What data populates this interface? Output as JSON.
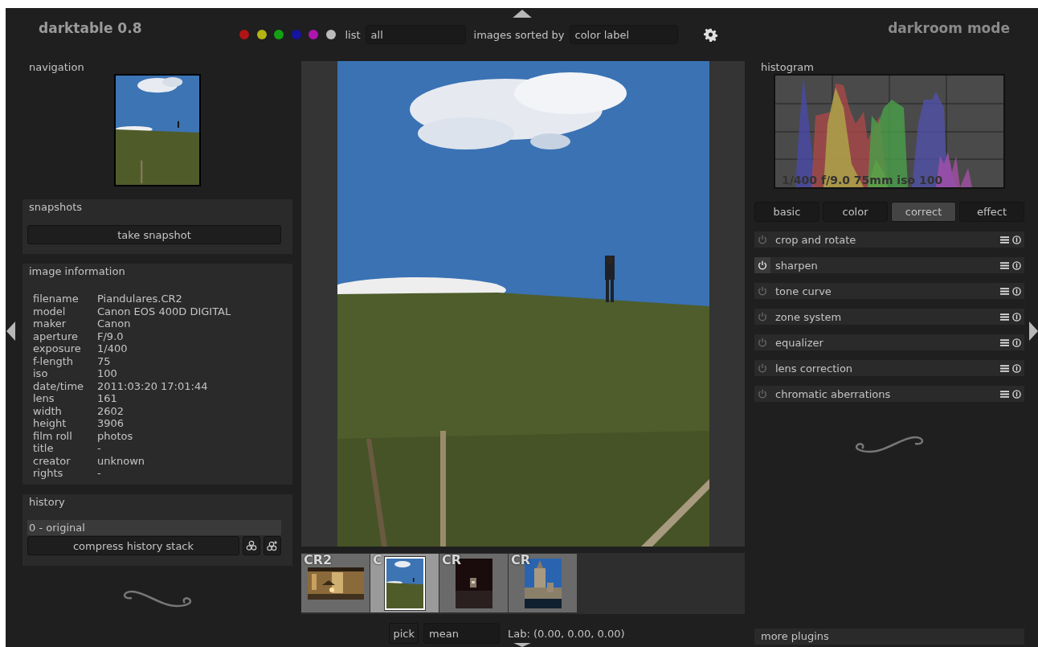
{
  "header": {
    "title": "darktable 0.8",
    "color_labels": [
      {
        "color": "#b01414"
      },
      {
        "color": "#b4b414"
      },
      {
        "color": "#14a014"
      },
      {
        "color": "#1414a0"
      },
      {
        "color": "#b014b0"
      },
      {
        "color": "#bbbbbb"
      }
    ],
    "filter_label": "list",
    "filter": {
      "value": "all"
    },
    "sort_label": "images sorted by",
    "sort": {
      "value": "color label"
    },
    "mode": "darkroom mode"
  },
  "left_panel": {
    "navigation": {
      "title": "navigation"
    },
    "snapshots": {
      "title": "snapshots",
      "button": "take snapshot"
    },
    "image_information": {
      "title": "image information",
      "rows": [
        {
          "label": "filename",
          "value": "Piandulares.CR2"
        },
        {
          "label": "model",
          "value": "Canon EOS 400D DIGITAL"
        },
        {
          "label": "maker",
          "value": "Canon"
        },
        {
          "label": "aperture",
          "value": "F/9.0"
        },
        {
          "label": "exposure",
          "value": "1/400"
        },
        {
          "label": "f-length",
          "value": "75"
        },
        {
          "label": "iso",
          "value": "100"
        },
        {
          "label": "date/time",
          "value": "2011:03:20 17:01:44"
        },
        {
          "label": "lens",
          "value": "161"
        },
        {
          "label": "width",
          "value": "2602"
        },
        {
          "label": "height",
          "value": "3906"
        },
        {
          "label": "film roll",
          "value": "photos"
        },
        {
          "label": "title",
          "value": "-"
        },
        {
          "label": "creator",
          "value": "unknown"
        },
        {
          "label": "rights",
          "value": "-"
        }
      ]
    },
    "history": {
      "title": "history",
      "items": [
        {
          "label": "0 - original",
          "selected": true
        }
      ],
      "button": "compress history stack"
    }
  },
  "filmstrip": [
    {
      "label": "CR2",
      "selected": false
    },
    {
      "label": "C",
      "selected": true
    },
    {
      "label": "CR",
      "selected": false
    },
    {
      "label": "CR",
      "selected": false
    }
  ],
  "bottom_bar": {
    "button": "pick",
    "mode": {
      "value": "mean"
    },
    "reading": "Lab: (0.00, 0.00, 0.00)"
  },
  "right_panel": {
    "histogram": {
      "title": "histogram",
      "overlay": "1/400 f/9.0 75mm iso 100"
    },
    "groups": [
      {
        "label": "basic",
        "selected": false
      },
      {
        "label": "color",
        "selected": false
      },
      {
        "label": "correct",
        "selected": true
      },
      {
        "label": "effect",
        "selected": false
      }
    ],
    "plugins": [
      {
        "name": "crop and rotate",
        "on": false
      },
      {
        "name": "sharpen",
        "on": true
      },
      {
        "name": "tone curve",
        "on": false
      },
      {
        "name": "zone system",
        "on": false
      },
      {
        "name": "equalizer",
        "on": false
      },
      {
        "name": "lens correction",
        "on": false
      },
      {
        "name": "chromatic aberrations",
        "on": false
      }
    ],
    "more_plugins": "more plugins"
  }
}
